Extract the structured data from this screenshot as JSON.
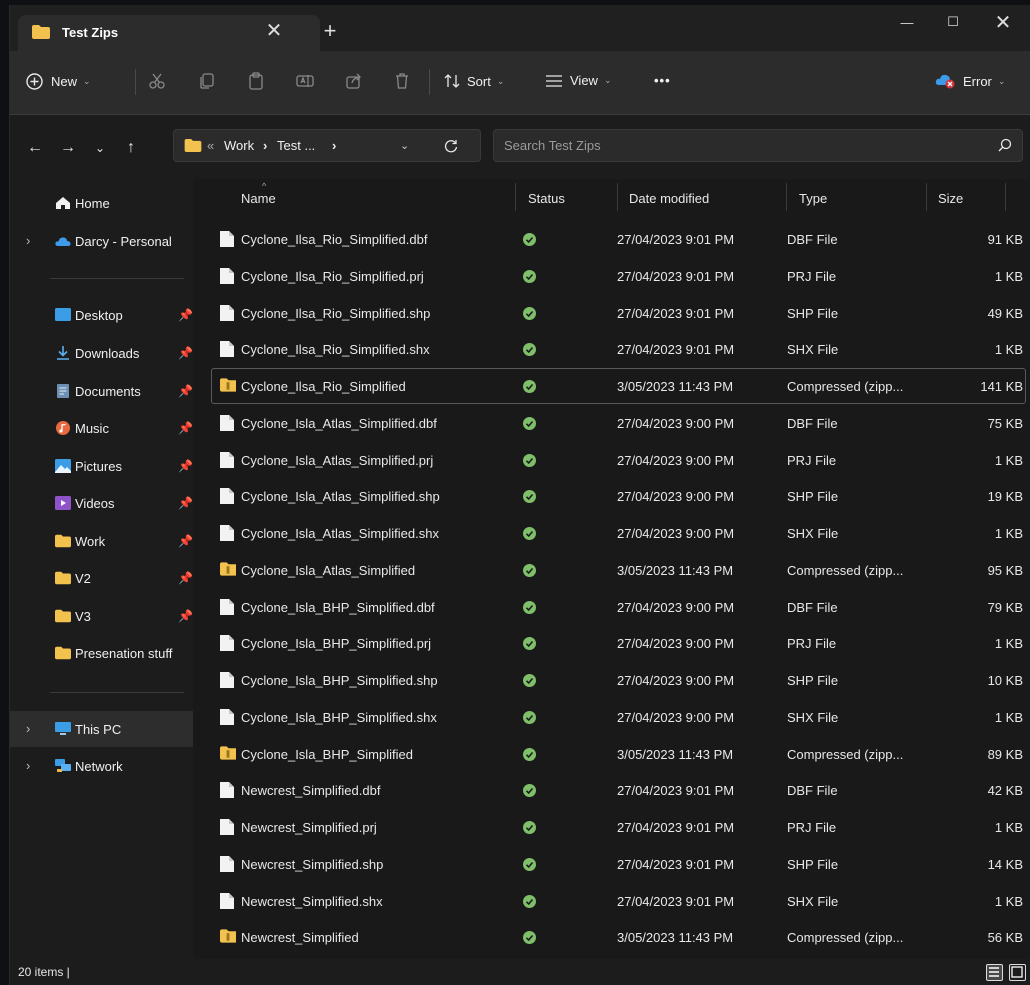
{
  "tab": {
    "title": "Test Zips",
    "close": "✕",
    "new": "+"
  },
  "window_controls": {
    "minimize": "—",
    "maximize": "☐",
    "close": "✕"
  },
  "toolbar": {
    "new_label": "New",
    "sort_label": "Sort",
    "view_label": "View",
    "more_label": "•••",
    "account_label": "Error"
  },
  "address": {
    "overflow": "«",
    "crumbs": [
      "Work",
      "Test ..."
    ],
    "separator": "›"
  },
  "search": {
    "placeholder": "Search Test Zips"
  },
  "sidebar": {
    "items": [
      {
        "label": "Home",
        "icon": "home-icon"
      },
      {
        "label": "Darcy - Personal",
        "icon": "onedrive-icon"
      },
      {
        "label": "Desktop",
        "icon": "desktop-icon",
        "pinned": true
      },
      {
        "label": "Downloads",
        "icon": "downloads-icon",
        "pinned": true
      },
      {
        "label": "Documents",
        "icon": "documents-icon",
        "pinned": true
      },
      {
        "label": "Music",
        "icon": "music-icon",
        "pinned": true
      },
      {
        "label": "Pictures",
        "icon": "pictures-icon",
        "pinned": true
      },
      {
        "label": "Videos",
        "icon": "videos-icon",
        "pinned": true
      },
      {
        "label": "Work",
        "icon": "folder-icon",
        "pinned": true
      },
      {
        "label": "V2",
        "icon": "folder-icon",
        "pinned": true
      },
      {
        "label": "V3",
        "icon": "folder-icon",
        "pinned": true
      },
      {
        "label": "Presenation stuff",
        "icon": "folder-icon"
      },
      {
        "label": "This PC",
        "icon": "this-pc-icon"
      },
      {
        "label": "Network",
        "icon": "network-icon"
      }
    ]
  },
  "columns": {
    "name": "Name",
    "status": "Status",
    "date": "Date modified",
    "type": "Type",
    "size": "Size"
  },
  "files": [
    {
      "name": "Cyclone_Ilsa_Rio_Simplified.dbf",
      "date": "27/04/2023 9:01 PM",
      "type": "DBF File",
      "size": "91 KB",
      "kind": "file"
    },
    {
      "name": "Cyclone_Ilsa_Rio_Simplified.prj",
      "date": "27/04/2023 9:01 PM",
      "type": "PRJ File",
      "size": "1 KB",
      "kind": "file"
    },
    {
      "name": "Cyclone_Ilsa_Rio_Simplified.shp",
      "date": "27/04/2023 9:01 PM",
      "type": "SHP File",
      "size": "49 KB",
      "kind": "file"
    },
    {
      "name": "Cyclone_Ilsa_Rio_Simplified.shx",
      "date": "27/04/2023 9:01 PM",
      "type": "SHX File",
      "size": "1 KB",
      "kind": "file"
    },
    {
      "name": "Cyclone_Ilsa_Rio_Simplified",
      "date": "3/05/2023 11:43 PM",
      "type": "Compressed (zipp...",
      "size": "141 KB",
      "kind": "zip"
    },
    {
      "name": "Cyclone_Isla_Atlas_Simplified.dbf",
      "date": "27/04/2023 9:00 PM",
      "type": "DBF File",
      "size": "75 KB",
      "kind": "file"
    },
    {
      "name": "Cyclone_Isla_Atlas_Simplified.prj",
      "date": "27/04/2023 9:00 PM",
      "type": "PRJ File",
      "size": "1 KB",
      "kind": "file"
    },
    {
      "name": "Cyclone_Isla_Atlas_Simplified.shp",
      "date": "27/04/2023 9:00 PM",
      "type": "SHP File",
      "size": "19 KB",
      "kind": "file"
    },
    {
      "name": "Cyclone_Isla_Atlas_Simplified.shx",
      "date": "27/04/2023 9:00 PM",
      "type": "SHX File",
      "size": "1 KB",
      "kind": "file"
    },
    {
      "name": "Cyclone_Isla_Atlas_Simplified",
      "date": "3/05/2023 11:43 PM",
      "type": "Compressed (zipp...",
      "size": "95 KB",
      "kind": "zip"
    },
    {
      "name": "Cyclone_Isla_BHP_Simplified.dbf",
      "date": "27/04/2023 9:00 PM",
      "type": "DBF File",
      "size": "79 KB",
      "kind": "file"
    },
    {
      "name": "Cyclone_Isla_BHP_Simplified.prj",
      "date": "27/04/2023 9:00 PM",
      "type": "PRJ File",
      "size": "1 KB",
      "kind": "file"
    },
    {
      "name": "Cyclone_Isla_BHP_Simplified.shp",
      "date": "27/04/2023 9:00 PM",
      "type": "SHP File",
      "size": "10 KB",
      "kind": "file"
    },
    {
      "name": "Cyclone_Isla_BHP_Simplified.shx",
      "date": "27/04/2023 9:00 PM",
      "type": "SHX File",
      "size": "1 KB",
      "kind": "file"
    },
    {
      "name": "Cyclone_Isla_BHP_Simplified",
      "date": "3/05/2023 11:43 PM",
      "type": "Compressed (zipp...",
      "size": "89 KB",
      "kind": "zip"
    },
    {
      "name": "Newcrest_Simplified.dbf",
      "date": "27/04/2023 9:01 PM",
      "type": "DBF File",
      "size": "42 KB",
      "kind": "file"
    },
    {
      "name": "Newcrest_Simplified.prj",
      "date": "27/04/2023 9:01 PM",
      "type": "PRJ File",
      "size": "1 KB",
      "kind": "file"
    },
    {
      "name": "Newcrest_Simplified.shp",
      "date": "27/04/2023 9:01 PM",
      "type": "SHP File",
      "size": "14 KB",
      "kind": "file"
    },
    {
      "name": "Newcrest_Simplified.shx",
      "date": "27/04/2023 9:01 PM",
      "type": "SHX File",
      "size": "1 KB",
      "kind": "file"
    },
    {
      "name": "Newcrest_Simplified",
      "date": "3/05/2023 11:43 PM",
      "type": "Compressed (zipp...",
      "size": "56 KB",
      "kind": "zip"
    }
  ],
  "statusbar": {
    "count": "20 items  |"
  },
  "colors": {
    "accent_folder": "#f2c14e",
    "status_ok": "#7fbf6a",
    "error_badge": "#d13438",
    "onedrive": "#3d9be9"
  }
}
